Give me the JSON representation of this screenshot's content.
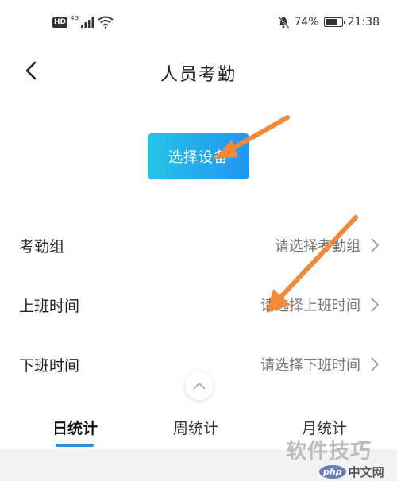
{
  "status_bar": {
    "hd": "HD",
    "network": "4G",
    "battery_percent": "74%",
    "battery_level": 0.74,
    "time": "21:38",
    "icons": [
      "signal-icon",
      "wifi-icon",
      "mute-bell-icon",
      "battery-icon"
    ]
  },
  "header": {
    "title": "人员考勤",
    "back_icon": "chevron-left-icon"
  },
  "select_device_label": "选择设备",
  "rows": [
    {
      "label": "考勤组",
      "value": "请选择考勤组"
    },
    {
      "label": "上班时间",
      "value": "请选择上班时间"
    },
    {
      "label": "下班时间",
      "value": "请选择下班时间"
    }
  ],
  "tabs": [
    {
      "label": "日统计",
      "active": true
    },
    {
      "label": "周统计",
      "active": false
    },
    {
      "label": "月统计",
      "active": false
    }
  ],
  "watermark": {
    "text": "软件技巧",
    "badge_logo": "php",
    "badge_text": "中文网"
  },
  "colors": {
    "accent": "#1e90e8",
    "button_gradient_start": "#25c3e6",
    "button_gradient_end": "#2196f3",
    "annotation_arrow": "#f08a3a"
  }
}
